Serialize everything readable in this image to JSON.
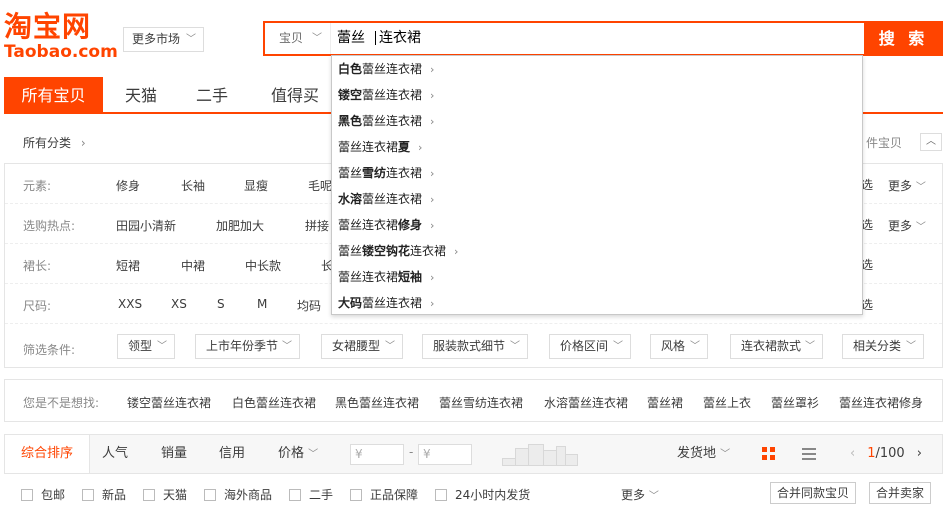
{
  "logo": {
    "cn": "淘宝网",
    "en": "Taobao.com"
  },
  "header": {
    "market_label": "更多市场"
  },
  "search": {
    "scope": "宝贝",
    "query_a": "蕾丝",
    "query_b": "连衣裙",
    "button": "搜 索"
  },
  "tabs": [
    "所有宝贝",
    "天猫",
    "二手",
    "值得买"
  ],
  "breadcrumb": {
    "label": "所有分类",
    "right_text": "件宝贝"
  },
  "filters": {
    "rows": [
      {
        "label": "元素:",
        "options": [
          "修身",
          "长袖",
          "显瘦",
          "毛呢"
        ],
        "select": "选",
        "more": "更多"
      },
      {
        "label": "选购热点:",
        "options": [
          "田园小清新",
          "加肥加大",
          "拼接"
        ],
        "select": "选",
        "more": "更多"
      },
      {
        "label": "裙长:",
        "options": [
          "短裙",
          "中裙",
          "中长款",
          "长"
        ],
        "select": "选"
      },
      {
        "label": "尺码:",
        "options": [
          "XXS",
          "XS",
          "S",
          "M",
          "均码"
        ],
        "select": "选"
      }
    ],
    "conditions_label": "筛选条件:",
    "conditions": [
      "领型",
      "上市年份季节",
      "女裙腰型",
      "服装款式细节",
      "价格区间",
      "风格",
      "连衣裙款式",
      "相关分类"
    ]
  },
  "suggest": {
    "label": "您是不是想找:",
    "items": [
      "镂空蕾丝连衣裙",
      "白色蕾丝连衣裙",
      "黑色蕾丝连衣裙",
      "蕾丝雪纺连衣裙",
      "水溶蕾丝连衣裙",
      "蕾丝裙",
      "蕾丝上衣",
      "蕾丝罩衫",
      "蕾丝连衣裙修身"
    ]
  },
  "sortbar": {
    "sorts": [
      "综合排序",
      "人气",
      "销量",
      "信用",
      "价格"
    ],
    "price_from": "¥",
    "price_to": "¥",
    "dash": "-",
    "ship_from": "发货地",
    "page_current": "1",
    "page_total": "/100"
  },
  "checks": {
    "items": [
      "包邮",
      "新品",
      "天猫",
      "海外商品",
      "二手",
      "正品保障",
      "24小时内发货"
    ],
    "more": "更多",
    "merge_same": "合并同款宝贝",
    "merge_seller": "合并卖家"
  },
  "dropdown": [
    {
      "bold": "白色",
      "rest": "蕾丝连衣裙",
      "bold_first": true
    },
    {
      "bold": "镂空",
      "rest": "蕾丝连衣裙",
      "bold_first": true
    },
    {
      "bold": "黑色",
      "rest": "蕾丝连衣裙",
      "bold_first": true
    },
    {
      "bold": "夏",
      "rest": "蕾丝连衣裙",
      "bold_first": false
    },
    {
      "pre": "蕾丝",
      "bold": "雪纺",
      "rest": "连衣裙"
    },
    {
      "bold": "水溶",
      "rest": "蕾丝连衣裙",
      "bold_first": true
    },
    {
      "bold": "修身",
      "rest": "蕾丝连衣裙",
      "bold_first": false
    },
    {
      "pre": "蕾丝",
      "bold": "镂空钩花",
      "rest": "连衣裙"
    },
    {
      "bold": "短袖",
      "rest": "蕾丝连衣裙",
      "bold_first": false
    },
    {
      "bold": "大码",
      "rest": "蕾丝连衣裙",
      "bold_first": true
    }
  ],
  "colors": {
    "brand": "#ff4400"
  }
}
